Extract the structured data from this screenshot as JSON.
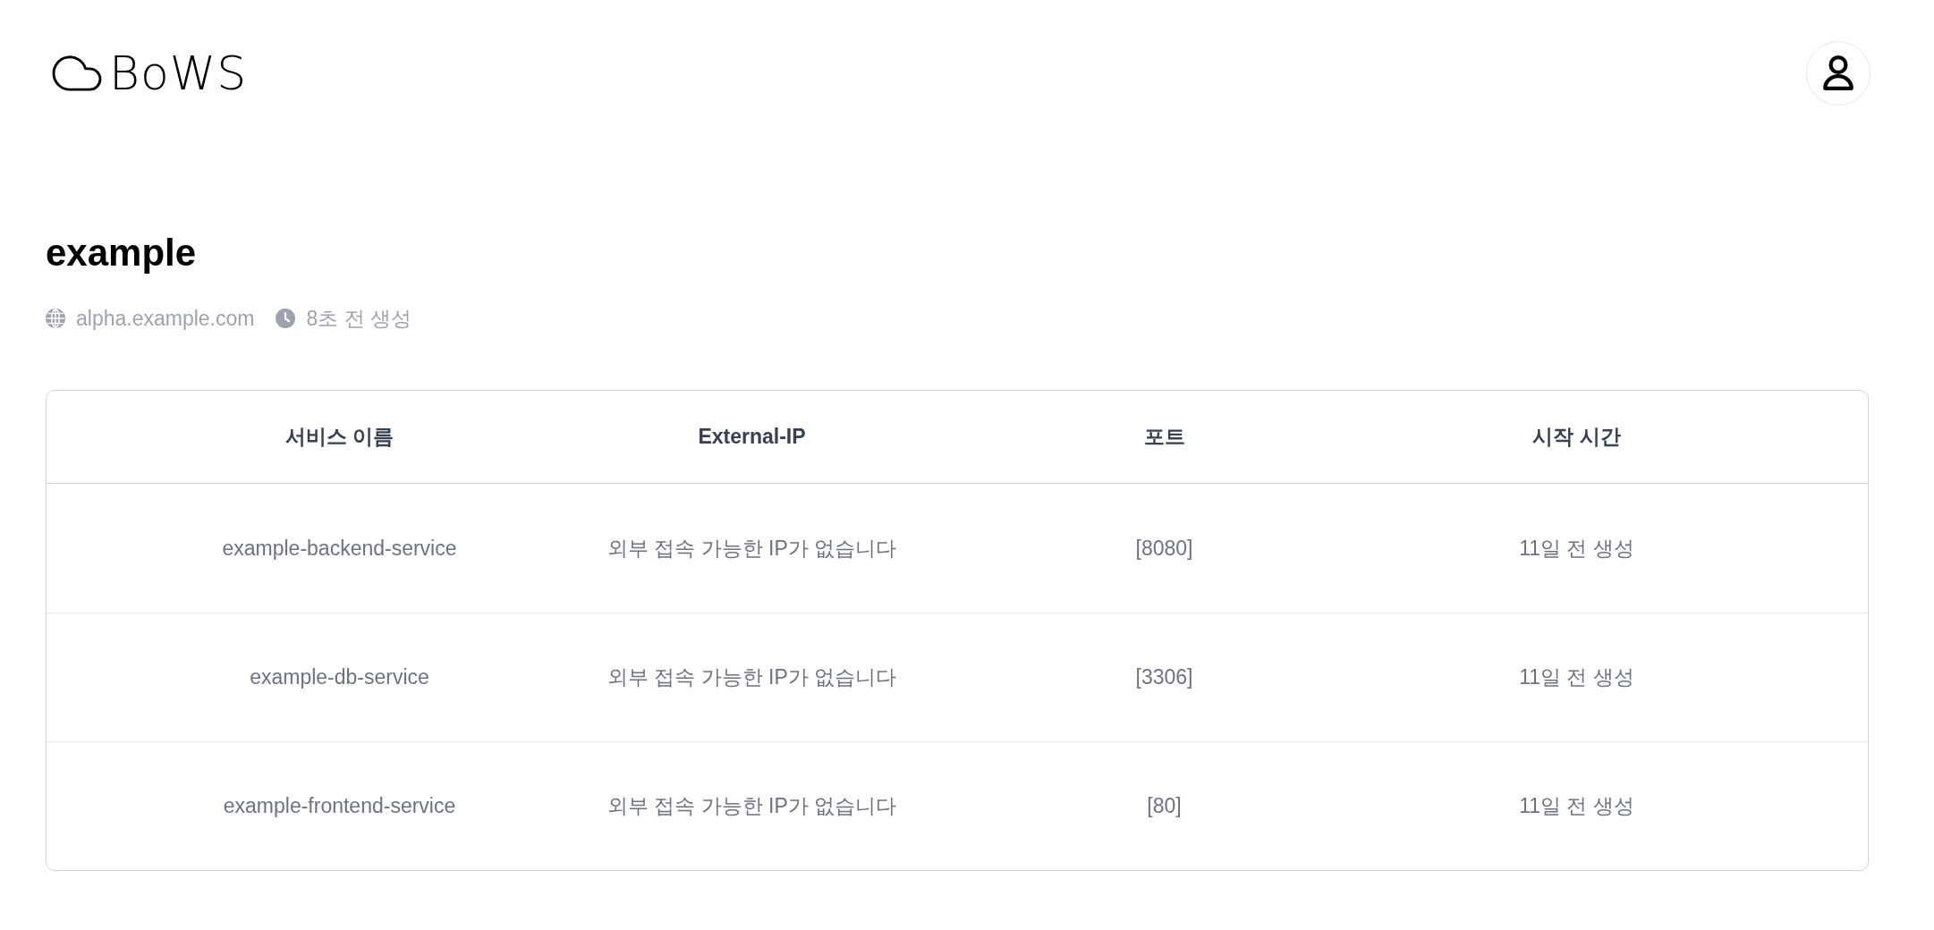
{
  "header": {
    "logo": "BoWS"
  },
  "project": {
    "title": "example",
    "domain": "alpha.example.com",
    "created": "8초 전 생성"
  },
  "table": {
    "columns": [
      "서비스 이름",
      "External-IP",
      "포트",
      "시작 시간"
    ],
    "rows": [
      [
        "example-backend-service",
        "외부 접속 가능한 IP가 없습니다",
        "[8080]",
        "11일 전 생성"
      ],
      [
        "example-db-service",
        "외부 접속 가능한 IP가 없습니다",
        "[3306]",
        "11일 전 생성"
      ],
      [
        "example-frontend-service",
        "외부 접속 가능한 IP가 없습니다",
        "[80]",
        "11일 전 생성"
      ]
    ]
  }
}
